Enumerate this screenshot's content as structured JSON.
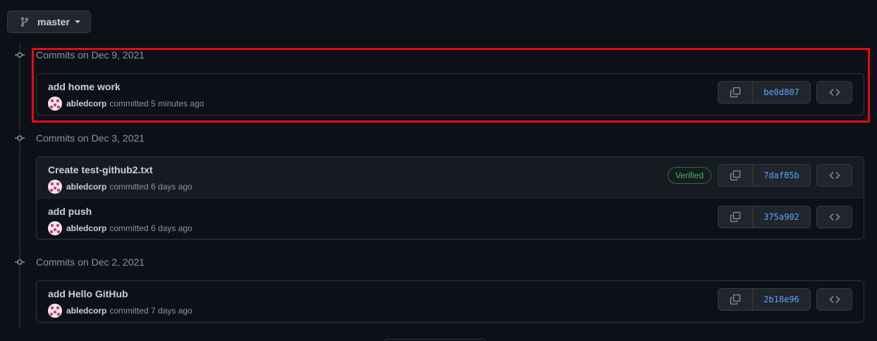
{
  "branch": {
    "name": "master",
    "icon": "git-branch-icon"
  },
  "colors": {
    "accent_red": "#e50914",
    "sha_blue": "#58a6ff",
    "verified_green": "#3fb950"
  },
  "groups": [
    {
      "label": "Commits on Dec 9, 2021",
      "commits": [
        {
          "title": "add home work",
          "author": "abledcorp",
          "when": "committed 5 minutes ago",
          "sha": "be0d807",
          "verified": ""
        }
      ]
    },
    {
      "label": "Commits on Dec 3, 2021",
      "commits": [
        {
          "title": "Create test-github2.txt",
          "author": "abledcorp",
          "when": "committed 6 days ago",
          "sha": "7daf05b",
          "verified": "Verified"
        },
        {
          "title": "add push",
          "author": "abledcorp",
          "when": "committed 6 days ago",
          "sha": "375a902",
          "verified": ""
        }
      ]
    },
    {
      "label": "Commits on Dec 2, 2021",
      "commits": [
        {
          "title": "add Hello GitHub",
          "author": "abledcorp",
          "when": "committed 7 days ago",
          "sha": "2b18e96",
          "verified": ""
        }
      ]
    }
  ]
}
